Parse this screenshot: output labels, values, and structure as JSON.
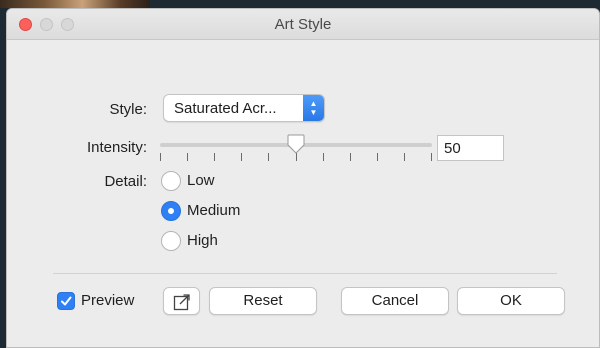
{
  "window": {
    "title": "Art Style"
  },
  "style": {
    "label": "Style:",
    "selected": "Saturated Acr..."
  },
  "intensity": {
    "label": "Intensity:",
    "value": "50",
    "fraction": 0.5,
    "tick_count": 11
  },
  "detail": {
    "label": "Detail:",
    "options": [
      "Low",
      "Medium",
      "High"
    ],
    "selected": "Medium"
  },
  "footer": {
    "preview_label": "Preview",
    "preview_checked": true,
    "reset_label": "Reset",
    "cancel_label": "Cancel",
    "ok_label": "OK"
  },
  "colors": {
    "accent": "#2f7ff5",
    "close": "#fc605c"
  },
  "icons": {
    "open_in": "open-external-icon"
  }
}
